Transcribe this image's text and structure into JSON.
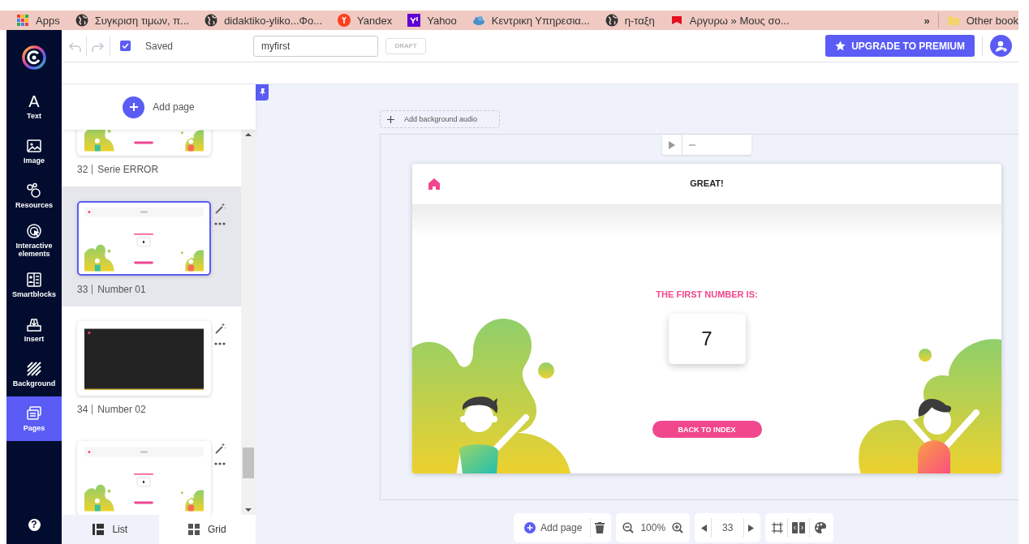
{
  "bookmarks": {
    "items": [
      {
        "label": "Apps",
        "kind": "apps"
      },
      {
        "label": "Συγκριση τιμων, π...",
        "kind": "globe"
      },
      {
        "label": "didaktiko-yliko...Φο...",
        "kind": "globe"
      },
      {
        "label": "Yandex",
        "kind": "yandex"
      },
      {
        "label": "Yahoo",
        "kind": "yahoo"
      },
      {
        "label": "Κεντρικη Υπηρεσια...",
        "kind": "cloud"
      },
      {
        "label": "η-ταξη",
        "kind": "globe"
      },
      {
        "label": "Αργυρω » Μους σο...",
        "kind": "red"
      }
    ],
    "more": "»",
    "other": {
      "label": "Other book",
      "kind": "folder"
    }
  },
  "nav": {
    "help": "?",
    "items": [
      {
        "label": "Text",
        "kind": "text",
        "glyph": "A",
        "selected": false
      },
      {
        "label": "Image",
        "kind": "image",
        "selected": false
      },
      {
        "label": "Resources",
        "kind": "resources",
        "selected": false
      },
      {
        "label": "Interactive elements",
        "kind": "interactive",
        "selected": false
      },
      {
        "label": "Smartblocks",
        "kind": "smartblocks",
        "selected": false
      },
      {
        "label": "Insert",
        "kind": "insert",
        "selected": false
      },
      {
        "label": "Background",
        "kind": "background",
        "selected": false
      },
      {
        "label": "Pages",
        "kind": "pages",
        "selected": true
      }
    ]
  },
  "toolbar": {
    "history": [
      {
        "kind": "undo",
        "disabled": true
      },
      {
        "kind": "redo",
        "disabled": true
      }
    ],
    "saved": {
      "label": "Saved",
      "checked": true
    },
    "title_value": "myfirst",
    "draft": "DRAFT",
    "upgrade": "UPGRADE TO PREMIUM"
  },
  "pages_panel": {
    "add_page": "Add page",
    "pages": [
      {
        "number": "32",
        "title": "Serie ERROR",
        "kind": "light",
        "selected": false,
        "partial": true
      },
      {
        "number": "33",
        "title": "Number 01",
        "kind": "light",
        "selected": true,
        "partial": false
      },
      {
        "number": "34",
        "title": "Number 02",
        "kind": "dark",
        "selected": false,
        "partial": false
      },
      {
        "kind": "light",
        "selected": false,
        "partial": false
      }
    ],
    "view_tabs": [
      {
        "label": "List",
        "kind": "list",
        "selected": true
      },
      {
        "label": "Grid",
        "kind": "grid",
        "selected": false
      }
    ]
  },
  "canvas": {
    "audio_button": "Add background audio",
    "slide": {
      "header_title": "GREAT!",
      "heading": "THE FIRST NUMBER IS:",
      "number": "7",
      "button": "BACK TO INDEX"
    }
  },
  "bottom_toolbar": {
    "add_page": "Add page",
    "zoom": "100%",
    "page": "33"
  }
}
